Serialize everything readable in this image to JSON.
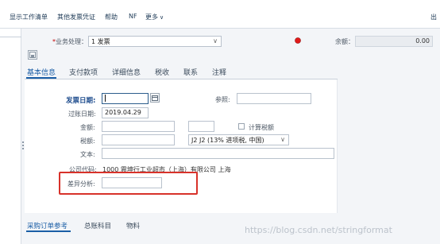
{
  "toolbar": {
    "show_worklist": "显示工作清单",
    "other_invoice": "其他发票凭证",
    "help": "帮助",
    "nf": "NF",
    "more": "更多",
    "exit": "出"
  },
  "header": {
    "transaction_label": "业务处理：",
    "transaction_value": "1 发票",
    "balance_label": "余额：",
    "balance_value": "0.00"
  },
  "tabs": [
    "基本信息",
    "支付款项",
    "详细信息",
    "税收",
    "联系",
    "注释"
  ],
  "form": {
    "invoice_date_label": "发票日期:",
    "invoice_date_value": "",
    "reference_label": "参照:",
    "reference_value": "",
    "posting_date_label": "过账日期:",
    "posting_date_value": "2019.04.29",
    "amount_label": "金额:",
    "amount_value": "",
    "currency_value": "",
    "calc_tax_label": "计算税额",
    "tax_label": "税额:",
    "tax_value": "",
    "tax_code_value": "J2 J2 (13% 进项税, 中国)",
    "text_label": "文本:",
    "text_value": "",
    "company_code_label": "公司代码:",
    "company_code_value": "1000 震坤行工业超市（上海）有限公司 上海",
    "difference_label": "差异分析:",
    "difference_value": ""
  },
  "bottom_tabs": [
    "采购订单参考",
    "总账科目",
    "物料"
  ],
  "watermark": "https://blog.csdn.net/stringformat",
  "colors": {
    "accent": "#1b5ea6",
    "highlight_box": "#d8322a",
    "status_light": "#e01a1a"
  }
}
